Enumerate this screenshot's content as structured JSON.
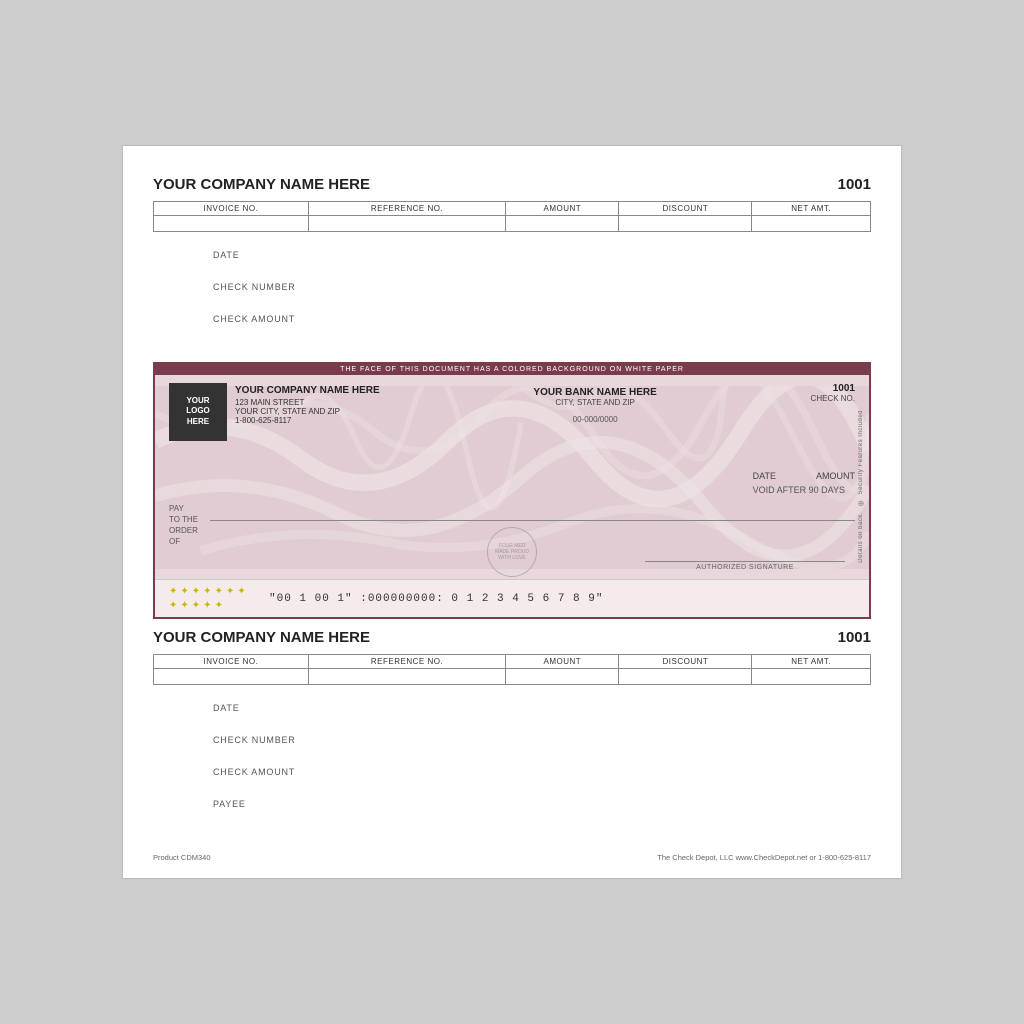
{
  "page": {
    "background": "#ccc"
  },
  "top_stub": {
    "company_name": "YOUR COMPANY NAME HERE",
    "check_number": "1001",
    "invoice_table": {
      "columns": [
        "INVOICE NO.",
        "REFERENCE NO.",
        "AMOUNT",
        "DISCOUNT",
        "NET AMT."
      ]
    },
    "fields": [
      {
        "label": "DATE"
      },
      {
        "label": "CHECK NUMBER"
      },
      {
        "label": "CHECK AMOUNT"
      }
    ]
  },
  "check": {
    "security_banner": "THE FACE OF THIS DOCUMENT HAS A COLORED BACKGROUND ON WHITE PAPER",
    "check_number": "1001",
    "logo": {
      "line1": "YOUR",
      "line2": "LOGO",
      "line3": "HERE"
    },
    "company": {
      "name": "YOUR COMPANY NAME HERE",
      "address1": "123 MAIN STREET",
      "address2": "YOUR CITY, STATE AND ZIP",
      "phone": "1-800-625-8117"
    },
    "bank": {
      "name": "YOUR BANK NAME HERE",
      "address": "CITY, STATE AND ZIP"
    },
    "routing": "00-000/0000",
    "check_no_label": "CHECK NO.",
    "date_label": "DATE",
    "amount_label": "AMOUNT",
    "void_label": "VOID AFTER 90 DAYS",
    "pay_label": "PAY\nTO THE\nORDER\nOF",
    "authorized_signature_label": "AUTHORIZED SIGNATURE",
    "micr": "\"00 1 00 1\"  :000000000:  0 1 2 3 4 5 6 7 8 9\"",
    "security_side_text": "Security Features Included",
    "security_side_icon": "⊕",
    "security_side_back": "Details on back.",
    "watermark_text": "FOUR MED MADE PROUD WITH LOVE"
  },
  "bottom_stub": {
    "company_name": "YOUR COMPANY NAME HERE",
    "check_number": "1001",
    "invoice_table": {
      "columns": [
        "INVOICE NO.",
        "REFERENCE NO.",
        "AMOUNT",
        "DISCOUNT",
        "NET AMT."
      ]
    },
    "fields": [
      {
        "label": "DATE"
      },
      {
        "label": "CHECK NUMBER"
      },
      {
        "label": "CHECK AMOUNT"
      }
    ],
    "payee_label": "PAYEE"
  },
  "footer": {
    "product_code": "Product CDM340",
    "company_info": "The Check Depot, LLC  www.CheckDepot.net  or  1-800-625-8117"
  }
}
